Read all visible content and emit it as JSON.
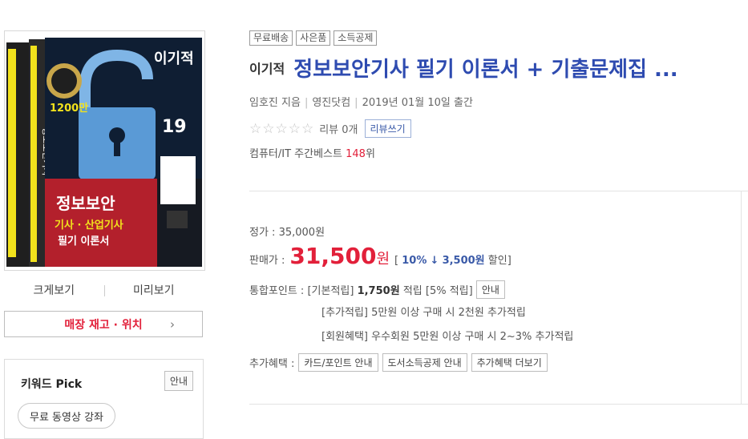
{
  "left": {
    "view_links": [
      "크게보기",
      "미리보기"
    ],
    "stock_button": "매장 재고 · 위치",
    "keyword": {
      "title": "키워드 Pick",
      "guide": "안내",
      "chip": "무료 동영상 강좌"
    },
    "cover": {
      "brand": "이기적",
      "year": "19",
      "sales": "1200만",
      "headline": "정보보안",
      "subline": "기사 · 산업기사",
      "subline2": "필기 이론서",
      "spine": "정보보안기사"
    }
  },
  "product": {
    "tags": [
      "무료배송",
      "사은품",
      "소득공제"
    ],
    "publisher_brand": "이기적",
    "title": "정보보안기사 필기 이론서 + 기출문제집 ...",
    "author": "임호진 지음",
    "publisher": "영진닷컴",
    "date": "2019년 01월 10일 출간",
    "stars": "☆☆☆☆☆",
    "review_count": "리뷰 0개",
    "review_button": "리뷰쓰기",
    "rank_prefix": "컴퓨터/IT 주간베스트",
    "rank_num": "148",
    "rank_suffix": "위"
  },
  "price": {
    "list_label": "정가 : ",
    "list_value": "35,000원",
    "sale_label": "판매가 :",
    "sale_value": "31,500",
    "sale_unit": "원",
    "discount_open": "[",
    "discount_rate": "10%",
    "discount_arrow": "↓",
    "discount_amount": "3,500원",
    "discount_text": "할인]"
  },
  "points": {
    "label": "통합포인트 :",
    "basic_label": "[기본적립]",
    "basic_value": "1,750원",
    "basic_text": "적립",
    "basic_rate": "[5% 적립]",
    "guide_button": "안내",
    "extra_line": "[추가적립]  5만원 이상 구매 시 2천원 추가적립",
    "member_line": "[회원혜택]  우수회원 5만원 이상 구매 시 2~3% 추가적립"
  },
  "benefits": {
    "label": "추가혜택 :",
    "buttons": [
      "카드/포인트 안내",
      "도서소득공제 안내",
      "추가혜택 더보기"
    ]
  }
}
